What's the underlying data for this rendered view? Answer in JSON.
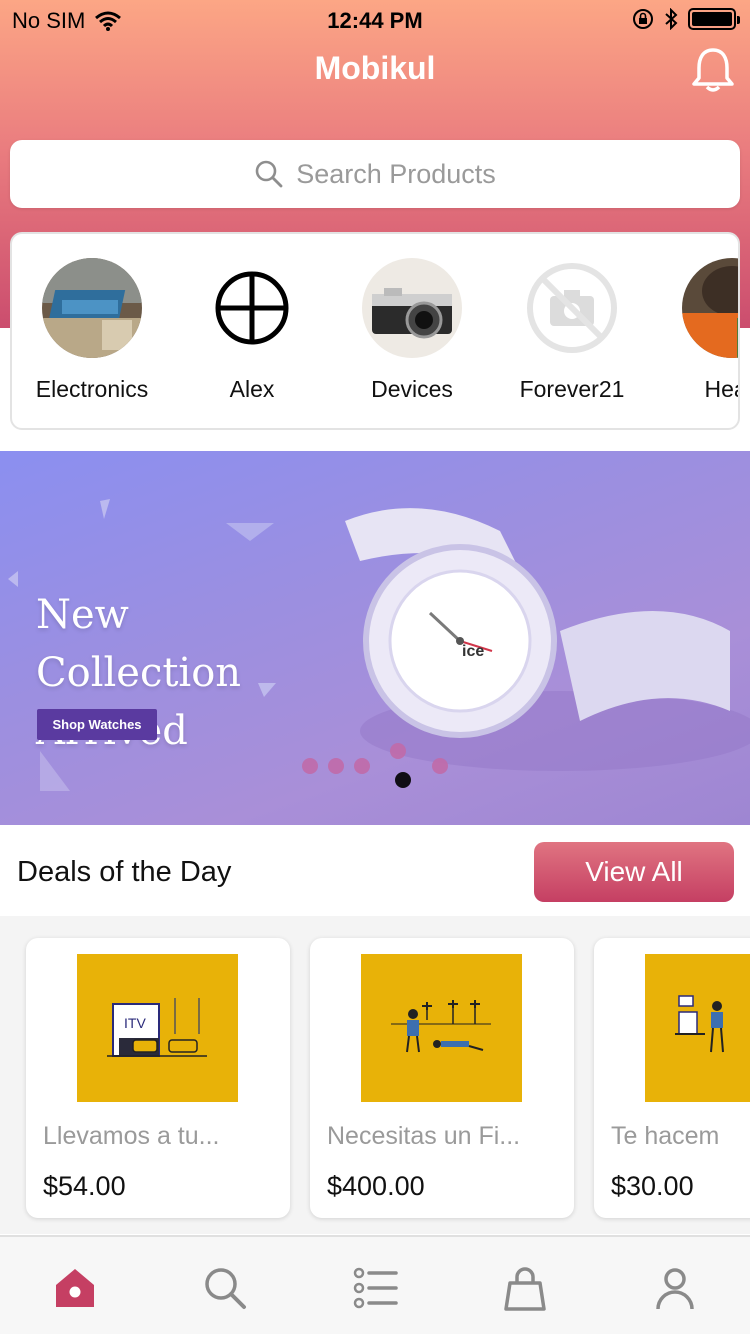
{
  "status_bar": {
    "carrier": "No SIM",
    "time": "12:44 PM"
  },
  "header": {
    "title": "Mobikul",
    "notification_icon": "bell-icon"
  },
  "search": {
    "placeholder": "Search Products",
    "icon": "search-icon"
  },
  "categories": [
    {
      "label": "Electronics"
    },
    {
      "label": "Alex"
    },
    {
      "label": "Devices"
    },
    {
      "label": "Forever21"
    },
    {
      "label": "Head"
    }
  ],
  "banner": {
    "heading_line1": "New Collection",
    "heading_line2": "Arrived",
    "button_label": "Shop Watches",
    "slide_count": 6,
    "active_slide": 5
  },
  "deals": {
    "title": "Deals of the Day",
    "view_all_label": "View All",
    "items": [
      {
        "name": "Llevamos a tu...",
        "price": "$54.00",
        "image_text": "ITV"
      },
      {
        "name": "Necesitas un Fi...",
        "price": "$400.00"
      },
      {
        "name": "Te hacem",
        "price": "$30.00"
      }
    ]
  },
  "tabbar": {
    "items": [
      {
        "icon": "home-icon",
        "active": true
      },
      {
        "icon": "search-icon",
        "active": false
      },
      {
        "icon": "list-icon",
        "active": false
      },
      {
        "icon": "bag-icon",
        "active": false
      },
      {
        "icon": "user-icon",
        "active": false
      }
    ]
  },
  "colors": {
    "accent": "#c53f63",
    "header_top": "#fca685",
    "header_bottom": "#cb4d6e",
    "deal_image_bg": "#e8b208"
  }
}
